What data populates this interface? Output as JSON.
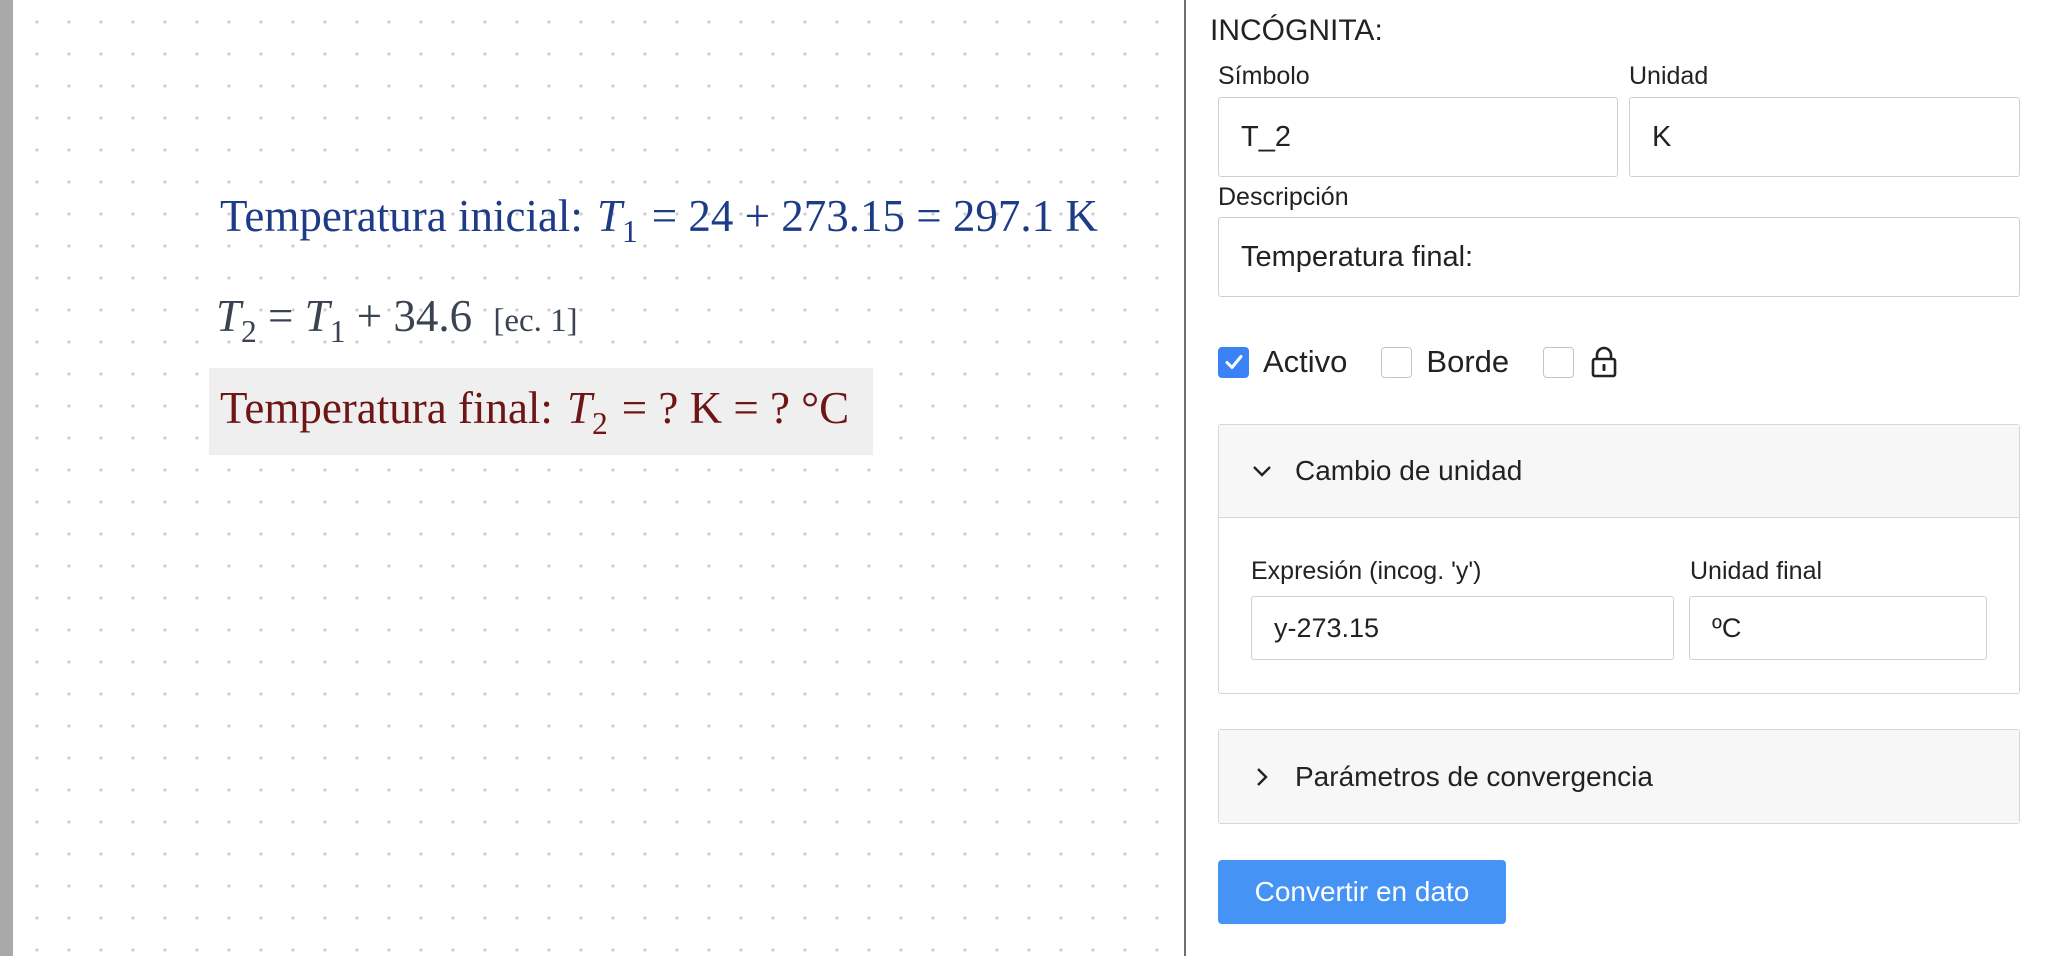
{
  "canvas": {
    "eq1": {
      "label": "Temperatura inicial:",
      "symbol": "T",
      "subscript": "1",
      "expression": "= 24 + 273.15 = 297.1 K"
    },
    "eq2": {
      "lhs_symbol": "T",
      "lhs_sub": "2",
      "rhs_symbol": "T",
      "rhs_sub": "1",
      "rhs_rest": "+ 34.6",
      "tag": "[ec. 1]"
    },
    "eq3": {
      "label": "Temperatura final:",
      "symbol": "T",
      "subscript": "2",
      "expression": "= ? K = ? °C"
    }
  },
  "panel": {
    "heading": "INCÓGNITA:",
    "symbol_label": "Símbolo",
    "symbol_value": "T_2",
    "unit_label": "Unidad",
    "unit_value": "K",
    "description_label": "Descripción",
    "description_value": "Temperatura final:",
    "checks": {
      "active_label": "Activo",
      "active_checked": true,
      "border_label": "Borde",
      "border_checked": false,
      "lock_checked": false
    },
    "unit_change": {
      "title": "Cambio de unidad",
      "expression_label": "Expresión (incog. 'y')",
      "expression_value": "y-273.15",
      "final_unit_label": "Unidad final",
      "final_unit_value": "ºC"
    },
    "convergence": {
      "title": "Parámetros de convergencia"
    },
    "convert_button": "Convertir en dato"
  },
  "colors": {
    "eq1": "#1d3b86",
    "eq2": "#3b4252",
    "eq3": "#6e1515",
    "accent": "#3b82f6",
    "button": "#4593f5"
  }
}
